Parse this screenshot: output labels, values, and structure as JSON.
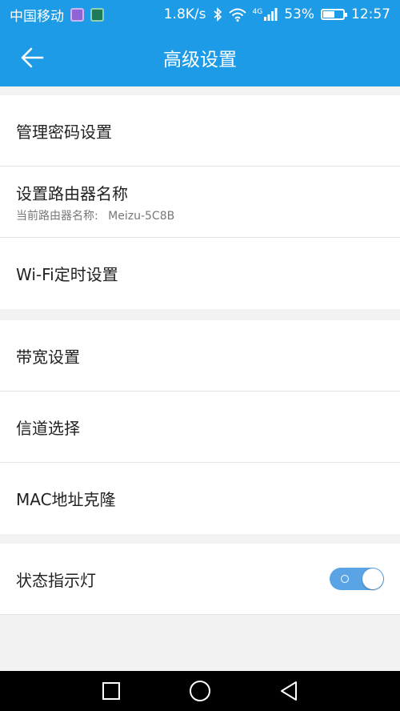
{
  "status_bar": {
    "carrier": "中国移动",
    "net_speed": "1.8K/s",
    "network_type": "4G",
    "battery": "53%",
    "battery_level": 0.53,
    "time": "12:57"
  },
  "app_bar": {
    "title": "高级设置",
    "back_icon": "arrow-left-icon"
  },
  "sections": {
    "group1": [
      {
        "title": "管理密码设置"
      },
      {
        "title": "设置路由器名称",
        "subtitle_label": "当前路由器名称:",
        "subtitle_value": "Meizu-5C8B"
      },
      {
        "title": "Wi-Fi定时设置"
      }
    ],
    "group2": [
      {
        "title": "带宽设置"
      },
      {
        "title": "信道选择"
      },
      {
        "title": "MAC地址克隆"
      }
    ],
    "group3": [
      {
        "title": "状态指示灯",
        "toggle_on": true
      }
    ]
  },
  "colors": {
    "primary": "#1e9be6",
    "toggle": "#5aa4e6",
    "background": "#f2f2f2"
  }
}
